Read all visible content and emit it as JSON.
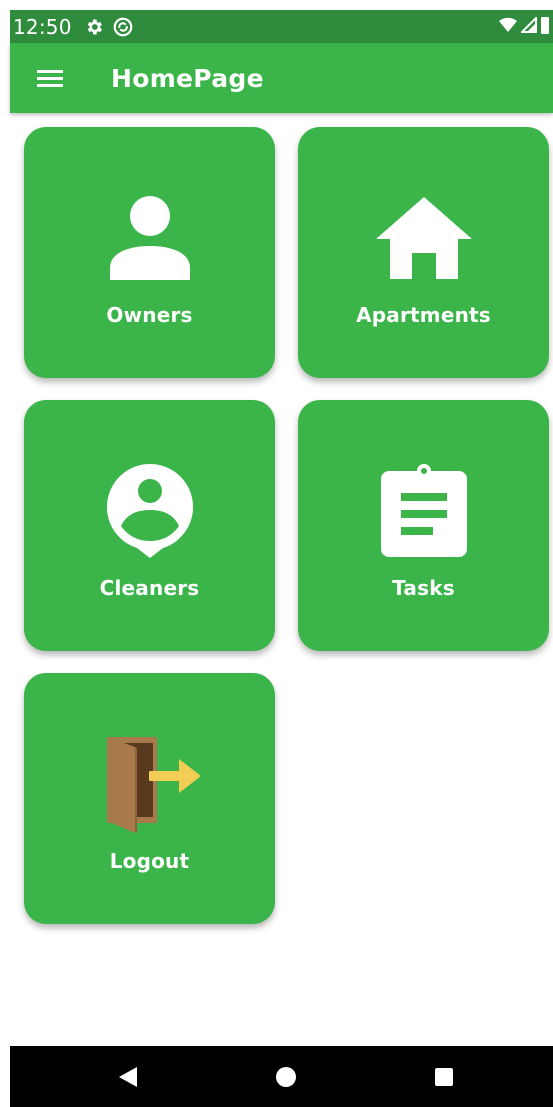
{
  "status_bar": {
    "time": "12:50",
    "icons": [
      "settings-gear-icon",
      "sync-circle-icon",
      "wifi-icon",
      "signal-icon",
      "battery-icon"
    ]
  },
  "app_bar": {
    "title": "HomePage",
    "menu_icon": "hamburger-menu-icon",
    "background": "#3bb54a"
  },
  "tiles": [
    {
      "label": "Owners",
      "icon": "person-icon"
    },
    {
      "label": "Apartments",
      "icon": "house-icon"
    },
    {
      "label": "Cleaners",
      "icon": "person-pin-icon"
    },
    {
      "label": "Tasks",
      "icon": "clipboard-icon"
    },
    {
      "label": "Logout",
      "icon": "door-exit-icon"
    }
  ],
  "nav_bar": {
    "buttons": [
      "back-triangle-icon",
      "home-circle-icon",
      "recents-square-icon"
    ]
  },
  "colors": {
    "primary": "#3bb54a",
    "status_bar": "#2f8c3d",
    "nav_bar": "#000000"
  }
}
